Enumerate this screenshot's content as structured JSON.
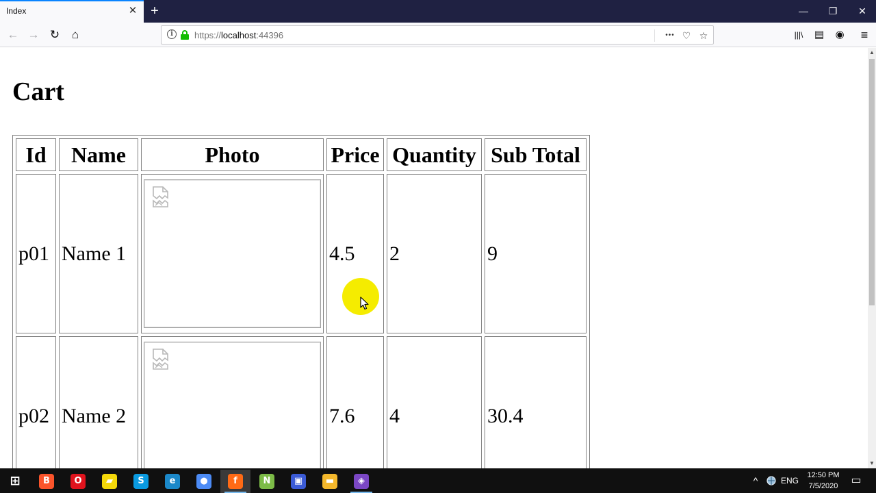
{
  "browser": {
    "tab_title": "Index",
    "tab_close_glyph": "✕",
    "new_tab_glyph": "+",
    "window_controls": {
      "minimize": "—",
      "restore": "❐",
      "close": "✕"
    },
    "nav": {
      "back": "←",
      "forward": "→",
      "reload": "↻",
      "home": "⌂"
    },
    "url_prefix": "https://",
    "url_host": "localhost",
    "url_port": ":44396",
    "page_actions": "•••",
    "pocket": "♡",
    "bookmark": "☆",
    "toolbar": {
      "library": "|||\\",
      "sidebar": "▤",
      "account": "◉",
      "menu": "≡"
    }
  },
  "page": {
    "title": "Cart",
    "table": {
      "headers": [
        "Id",
        "Name",
        "Photo",
        "Price",
        "Quantity",
        "Sub Total"
      ],
      "rows": [
        {
          "id": "p01",
          "name": "Name 1",
          "price": "4.5",
          "quantity": "2",
          "subtotal": "9"
        },
        {
          "id": "p02",
          "name": "Name 2",
          "price": "7.6",
          "quantity": "4",
          "subtotal": "30.4"
        }
      ]
    }
  },
  "taskbar": {
    "apps": [
      {
        "name": "start",
        "glyph": "⊞",
        "color": "#101010"
      },
      {
        "name": "brave",
        "glyph": "B",
        "color": "#fb542b"
      },
      {
        "name": "opera",
        "glyph": "O",
        "color": "#e0131d"
      },
      {
        "name": "sticky-notes",
        "glyph": "▰",
        "color": "#f4d80a"
      },
      {
        "name": "skype",
        "glyph": "S",
        "color": "#0a9ae0"
      },
      {
        "name": "edge",
        "glyph": "e",
        "color": "#1b88c9"
      },
      {
        "name": "chrome",
        "glyph": "●",
        "color": "#4c8bf5"
      },
      {
        "name": "firefox",
        "glyph": "f",
        "color": "#ff6a15"
      },
      {
        "name": "notepad-plus",
        "glyph": "N",
        "color": "#7cbb47"
      },
      {
        "name": "save-tool",
        "glyph": "▣",
        "color": "#3b5bd6"
      },
      {
        "name": "file-explorer",
        "glyph": "▬",
        "color": "#f3b72c"
      },
      {
        "name": "visual-studio",
        "glyph": "◈",
        "color": "#7b47c4"
      }
    ],
    "tray": {
      "chevron": "^",
      "language": "ENG",
      "notification": "▭"
    },
    "clock_time": "12:50 PM",
    "clock_date": "7/5/2020"
  }
}
